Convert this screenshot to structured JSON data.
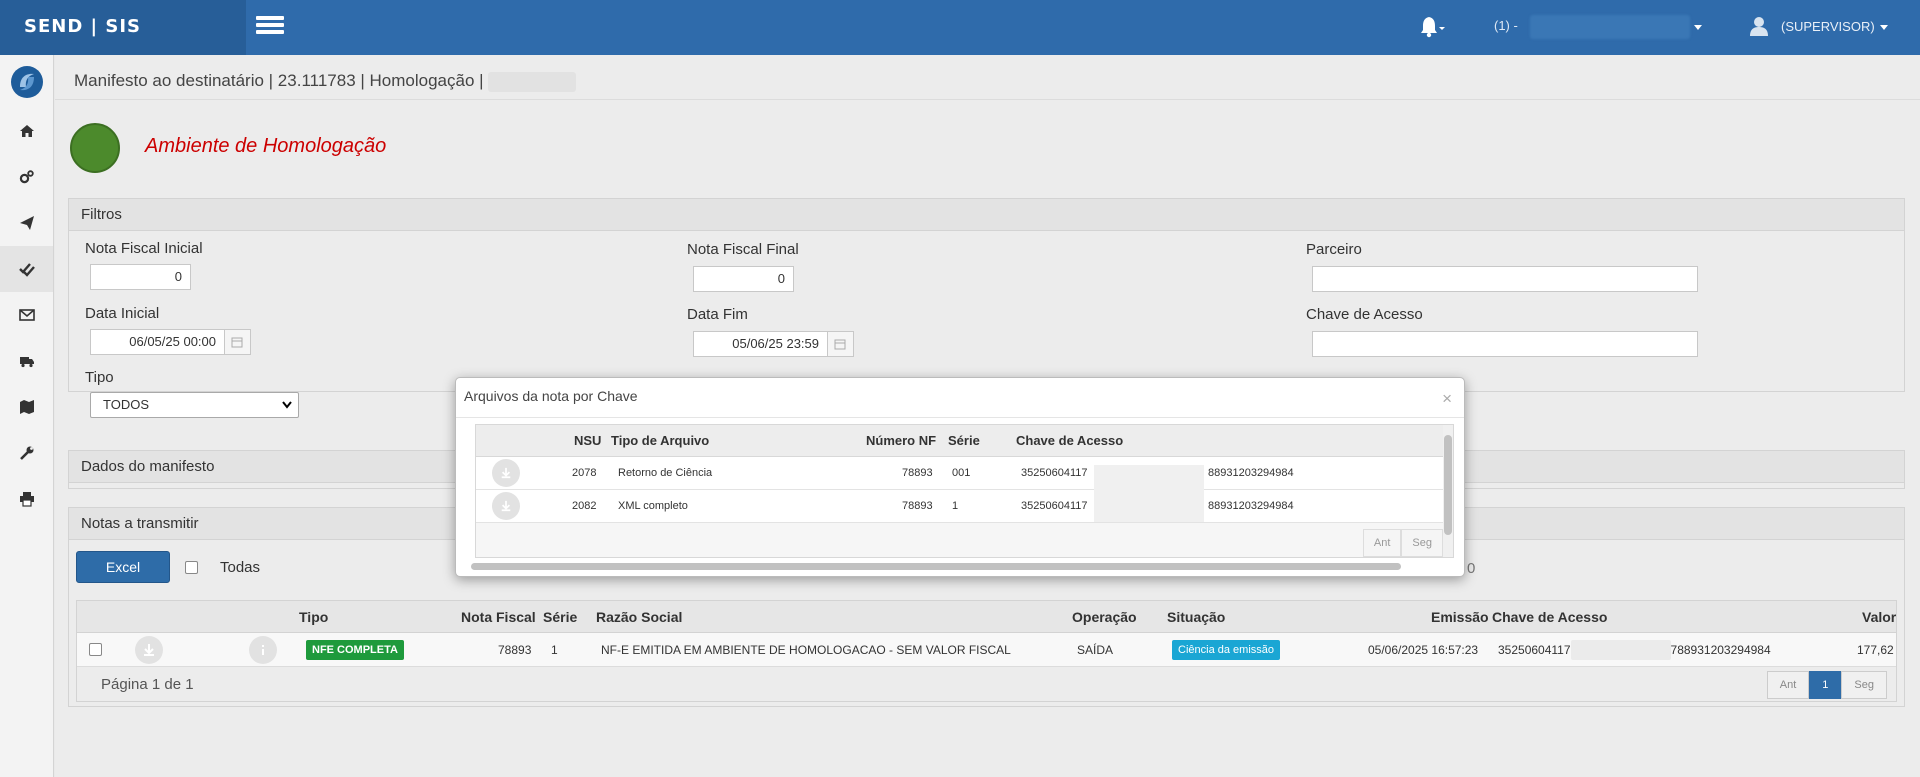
{
  "app": {
    "brand": "SEND | SIS"
  },
  "header": {
    "company_label": "(1) -",
    "user_label": "(SUPERVISOR)"
  },
  "breadcrumb": "Manifesto ao destinatário | 23.111783 | Homologação |",
  "environment": {
    "title": "Ambiente de Homologação"
  },
  "filters": {
    "title": "Filtros",
    "nf_inicial_label": "Nota Fiscal Inicial",
    "nf_inicial_value": "0",
    "nf_final_label": "Nota Fiscal Final",
    "nf_final_value": "0",
    "parceiro_label": "Parceiro",
    "parceiro_value": "",
    "data_inicial_label": "Data Inicial",
    "data_inicial_value": "06/05/25 00:00",
    "data_fim_label": "Data Fim",
    "data_fim_value": "05/06/25 23:59",
    "chave_label": "Chave de Acesso",
    "chave_value": "",
    "tipo_label": "Tipo",
    "tipo_value": "TODOS"
  },
  "dados_manifesto": {
    "title": "Dados do manifesto"
  },
  "notas": {
    "title": "Notas a transmitir",
    "excel_label": "Excel",
    "todas_label": "Todas",
    "partial_zero": "0",
    "columns": {
      "tipo": "Tipo",
      "nota_fiscal": "Nota Fiscal",
      "serie": "Série",
      "razao_social": "Razão Social",
      "operacao": "Operação",
      "situacao": "Situação",
      "emissao": "Emissão",
      "chave": "Chave de Acesso",
      "valor": "Valor"
    },
    "rows": [
      {
        "tipo": "NFE COMPLETA",
        "nota_fiscal": "78893",
        "serie": "1",
        "razao_social": "NF-E EMITIDA EM AMBIENTE DE HOMOLOGACAO - SEM VALOR FISCAL",
        "operacao": "SAÍDA",
        "situacao": "Ciência da emissão",
        "emissao": "05/06/2025 16:57:23",
        "chave_start": "35250604117",
        "chave_end": "788931203294984",
        "valor": "177,62"
      }
    ],
    "footer": "Página 1 de 1",
    "pager": {
      "prev": "Ant",
      "current": "1",
      "next": "Seg"
    }
  },
  "modal": {
    "title": "Arquivos da nota por Chave",
    "close": "×",
    "columns": {
      "nsu": "NSU",
      "tipo_arquivo": "Tipo de Arquivo",
      "numero_nf": "Número NF",
      "serie": "Série",
      "chave": "Chave de Acesso"
    },
    "rows": [
      {
        "nsu": "2078",
        "tipo_arquivo": "Retorno de Ciência",
        "numero_nf": "78893",
        "serie": "001",
        "chave_start": "35250604117",
        "chave_end": "88931203294984"
      },
      {
        "nsu": "2082",
        "tipo_arquivo": "XML completo",
        "numero_nf": "78893",
        "serie": "1",
        "chave_start": "35250604117",
        "chave_end": "88931203294984"
      }
    ],
    "pager": {
      "prev": "Ant",
      "next": "Seg"
    }
  },
  "colors": {
    "topbar": "#2f6bab",
    "env_title": "#cc0000",
    "badge_green": "#1e9a3c",
    "badge_cyan": "#1aa6d4",
    "primary_button": "#2e6ca8"
  }
}
